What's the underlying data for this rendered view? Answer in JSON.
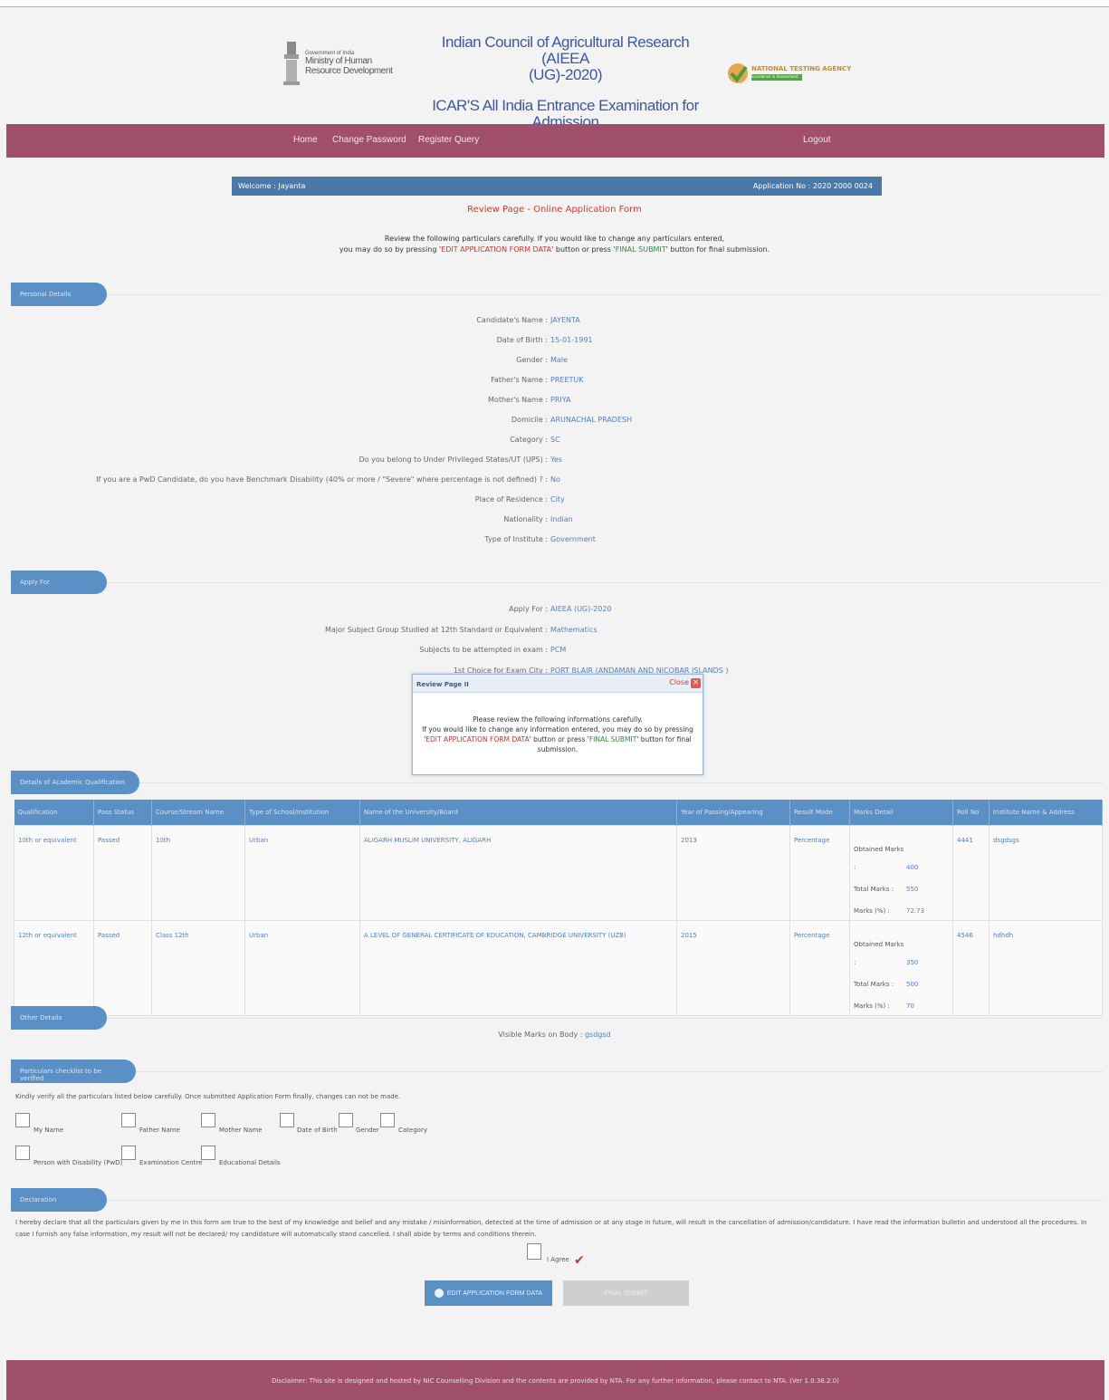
{
  "header": {
    "gov_line1": "Government of India",
    "gov_line2": "Ministry of Human Resource Development",
    "title_line1": "Indian Council of Agricultural Research (AIEEA",
    "title_line2": "(UG)-2020)",
    "title_line3": "ICAR'S All India Entrance Examination for",
    "title_line4": "Admission",
    "nta_name": "NATIONAL TESTING AGENCY",
    "nta_sub": "Excellence in Assessment"
  },
  "nav": {
    "home": "Home",
    "change_password": "Change Password",
    "register_query": "Register Query",
    "logout": "Logout"
  },
  "welcome": {
    "text": "Welcome : Jayanta",
    "application_no": "Application No : 2020 2000 0024"
  },
  "review": {
    "title": "Review Page - Online Application Form",
    "line1": "Review the following particulars carefully. If you would like to change any particulars entered,",
    "line2_a": "you may do so by pressing '",
    "edit_label": "EDIT APPLICATION FORM DATA",
    "line2_b": "' button or press '",
    "final_label": "FINAL SUBMIT",
    "line2_c": "' button for final submission."
  },
  "sections": {
    "personal": "Personal Details",
    "apply_for": "Apply For",
    "qualification": "Details of Academic Qualification",
    "other": "Other Details",
    "checklist": "Particulars checklist to be verified",
    "declaration": "Declaration"
  },
  "personal": [
    {
      "label": "Candidate's Name :",
      "value": "JAYENTA"
    },
    {
      "label": "Date of Birth :",
      "value": "15-01-1991"
    },
    {
      "label": "Gender :",
      "value": "Male"
    },
    {
      "label": "Father's Name :",
      "value": "PREETUK"
    },
    {
      "label": "Mother's Name :",
      "value": "PRIYA"
    },
    {
      "label": "Domicile :",
      "value": "ARUNACHAL PRADESH"
    },
    {
      "label": "Category :",
      "value": "SC"
    },
    {
      "label": "Do you belong to Under Privileged States/UT (UPS) :",
      "value": "Yes"
    },
    {
      "label": "If you are a PwD Candidate, do you have Benchmark Disability (40% or more / \"Severe\" where percentage is not defined) ? :",
      "value": "No"
    },
    {
      "label": "Place of Residence :",
      "value": "City"
    },
    {
      "label": "Nationality :",
      "value": "Indian"
    },
    {
      "label": "Type of Institute :",
      "value": "Government"
    }
  ],
  "apply": [
    {
      "label": "Apply For :",
      "value": "AIEEA (UG)-2020"
    },
    {
      "label": "Major Subject Group Studied at 12th Standard or Equivalent :",
      "value": "Mathematics"
    },
    {
      "label": "Subjects to be attempted in exam :",
      "value": "PCM"
    },
    {
      "label": "1st Choice for Exam City :",
      "value": "PORT BLAIR (ANDAMAN AND NICOBAR ISLANDS )"
    }
  ],
  "table": {
    "headers": [
      "Qualification",
      "Pass Status",
      "Course/Stream Name",
      "Type of School/Institution",
      "Name of the University/Board",
      "Year of Passing/Appearing",
      "Result Mode",
      "Marks Detail",
      "Roll No",
      "Institute Name & Address"
    ],
    "rows": [
      {
        "qualification": "10th or equivalent",
        "status": "Passed",
        "course": "10th",
        "school_type": "Urban",
        "board": "ALIGARH MUSLIM UNIVERSITY, ALIGARH",
        "year": "2013",
        "mode": "Percentage",
        "obtained_label": "Obtained Marks :",
        "obtained": "400",
        "total_label": "Total Marks :",
        "total": "550",
        "pct_label": "Marks (%) :",
        "pct": "72.73",
        "roll": "4441",
        "institute": "dsgdsgs"
      },
      {
        "qualification": "12th or equivalent",
        "status": "Passed",
        "course": "Class 12th",
        "school_type": "Urban",
        "board": "A LEVEL OF GENERAL CERTIFICATE OF EDUCATION, CAMBRIDGE UNIVERSITY (UZB)",
        "year": "2015",
        "mode": "Percentage",
        "obtained_label": "Obtained Marks :",
        "obtained": "350",
        "total_label": "Total Marks :",
        "total": "500",
        "pct_label": "Marks (%) :",
        "pct": "70",
        "roll": "4546",
        "institute": "hdhdh"
      }
    ]
  },
  "other": {
    "label": "Visible Marks on Body :",
    "value": "gsdgsd"
  },
  "checklist": {
    "note": "Kindly verify all the particulars listed below carefully. Once submitted Application Form finally, changes can not be made.",
    "items": [
      "My Name",
      "Father Name",
      "Mother Name",
      "Date of Birth",
      "Gender",
      "Category",
      "Person with Disability (PwD)",
      "Examination Centre",
      "Educational Details"
    ]
  },
  "declaration": {
    "text": "I hereby declare that all the particulars given by me in this form are true to the best of my knowledge and belief and any mistake / misinformation, detected at the time of admission or at any stage in future, will result in the cancellation of admission/candidature. I have read the information bulletin and understood all the procedures. In case I furnish any false information, my result will not be declared/ my candidature will automatically stand cancelled. I shall abide by terms and conditions therein.",
    "agree": "I Agree"
  },
  "buttons": {
    "edit": "EDIT APPLICATION FORM DATA",
    "final": "FINAL SUBMIT"
  },
  "footer": "Disclaimer: This site is designed and hosted by NIC Counselling Division and the contents are provided by NTA. For any further information, please contact to NTA. (Ver 1.0.36.2.0)",
  "popup": {
    "title": "Review Page II",
    "close": "Close",
    "line1": "Please review the following informations carefully.",
    "line2": "If you would like to change any information entered, you may do so by pressing",
    "line3_a": "'",
    "edit_label": "EDIT APPLICATION FORM DATA",
    "line3_b": "' button or press '",
    "final_label": "FINAL SUBMIT",
    "line3_c": "' button for final",
    "line4": "submission."
  }
}
